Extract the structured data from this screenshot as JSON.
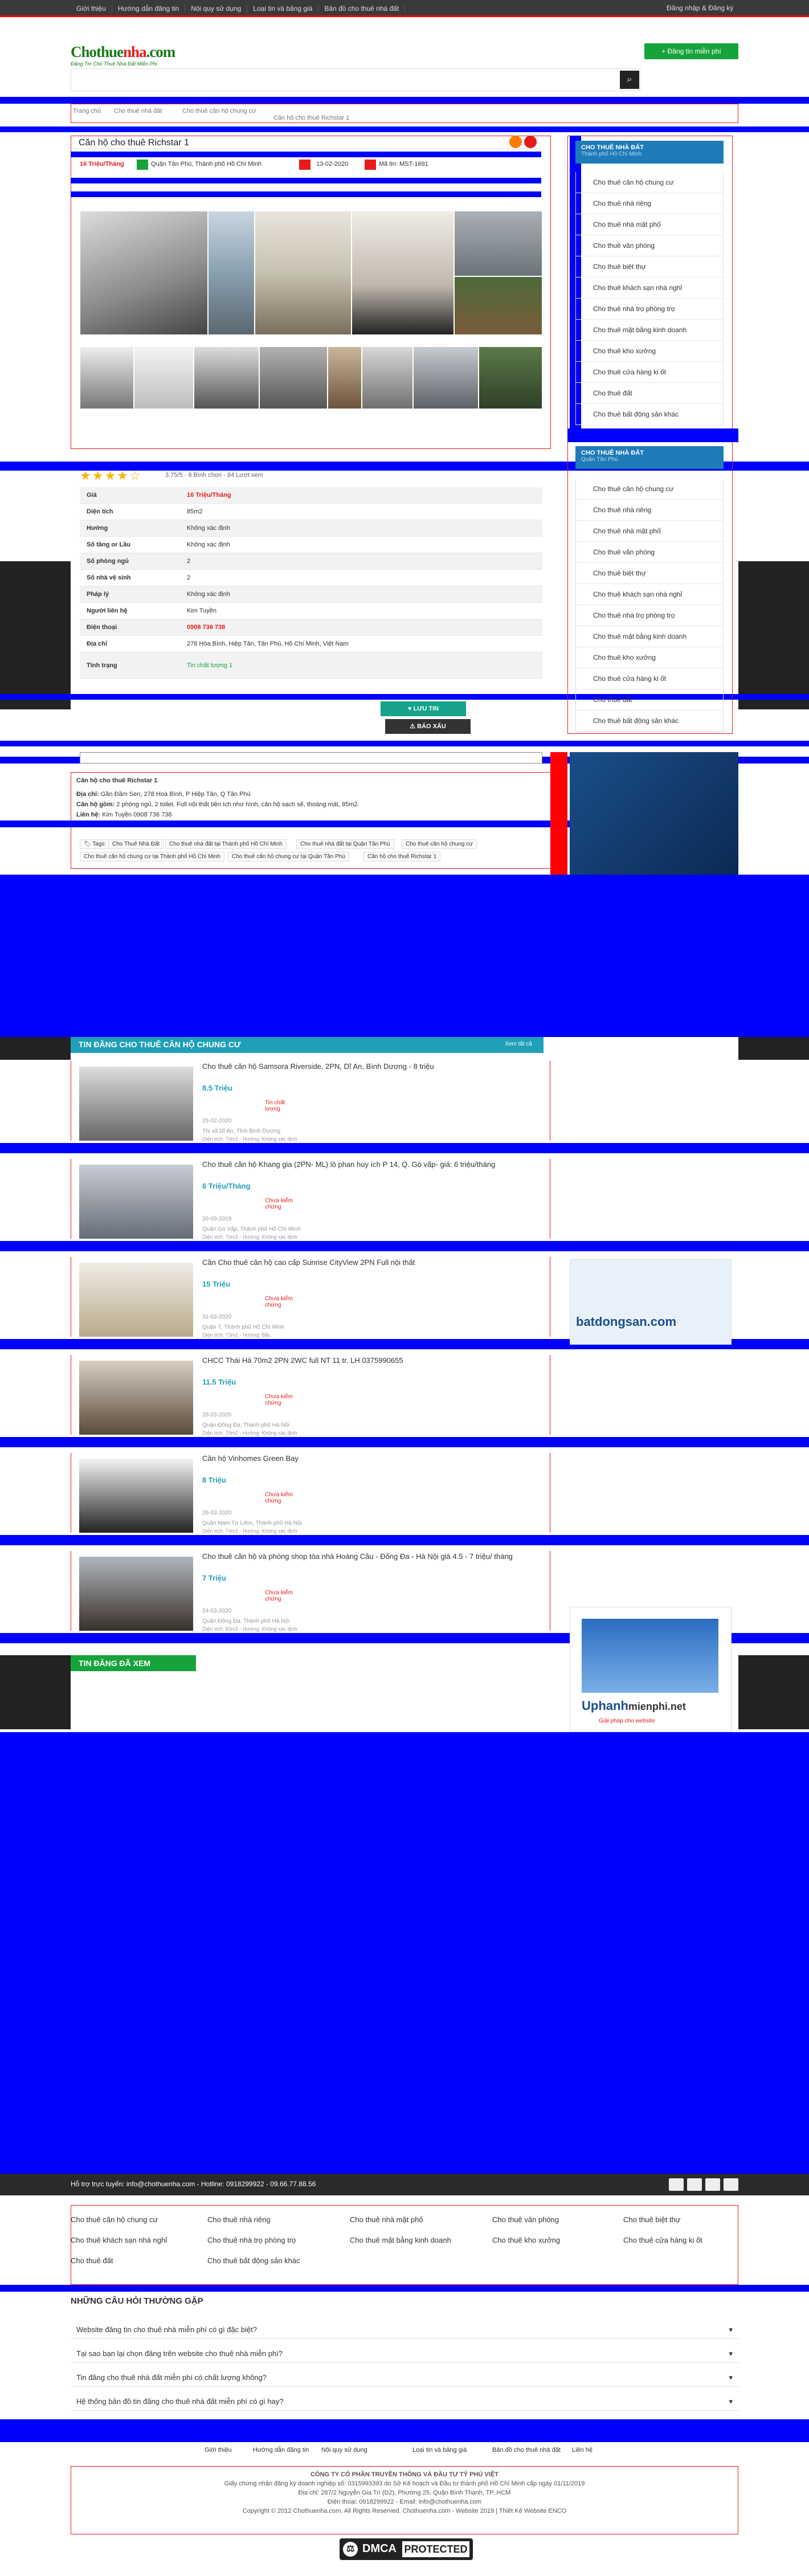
{
  "topbar": {
    "menu": [
      "Giới thiệu",
      "Hướng dẫn đăng tin",
      "Nội quy sử dụng",
      "Loại tin và bảng giá",
      "Bản đồ cho thuê nhà đất"
    ],
    "login": "Đăng nhập & Đăng ký"
  },
  "header": {
    "logo_main": "Chothue",
    "logo_accent": "nha",
    "logo_tld": ".com",
    "logo_tagline": "Đăng Tin Cho Thuê Nhà Đất Miễn Phí",
    "post_button": "Đăng tin miễn phí"
  },
  "breadcrumb": [
    "Trang chủ",
    "Cho thuê nhà đất",
    "Cho thuê căn hộ chung cư",
    "Căn hộ cho thuê Richstar 1"
  ],
  "listing": {
    "title": "Căn hộ cho thuê Richstar 1",
    "price": "16 Triệu/Tháng",
    "location": "Quận Tân Phú, Thành phố Hồ Chí Minh",
    "date": "13-02-2020",
    "code": "Mã tin: MST-1691",
    "rating_text": "3.75/5 - 8 Bình chọn - 84 Lượt xem",
    "details": [
      {
        "k": "Giá",
        "v": "16 Triệu/Tháng"
      },
      {
        "k": "Diện tích",
        "v": "85m2"
      },
      {
        "k": "Hướng",
        "v": "Không xác định"
      },
      {
        "k": "Số tầng or Lầu",
        "v": "Không xác định"
      },
      {
        "k": "Số phòng ngủ",
        "v": "2"
      },
      {
        "k": "Số nhà vệ sinh",
        "v": "2"
      },
      {
        "k": "Pháp lý",
        "v": "Không xác định"
      },
      {
        "k": "Người liên hệ",
        "v": "Kim Tuyền"
      },
      {
        "k": "Điện thoại",
        "v": "0908 736 738"
      },
      {
        "k": "Địa chỉ",
        "v": "278 Hòa Bình, Hiệp Tân, Tân Phú, Hồ Chí Minh, Việt Nam"
      },
      {
        "k": "Tình trạng",
        "v": "Tin chất lượng 1"
      }
    ],
    "save_button": "LƯU TIN",
    "report_button": "BÁO XẤU"
  },
  "description": {
    "heading": "Căn hộ cho thuê Richstar 1",
    "address_label": "Địa chỉ:",
    "address": "Gần Đầm Sen, 278 Hoà Bình, P Hiệp Tân, Q Tân Phú",
    "structure_label": "Căn hộ gồm:",
    "structure": "2 phòng ngủ, 2 toilet. Full nội thất tiện ích như hình, căn hộ sạch sẽ, thoáng mát, 85m2.",
    "contact_label": "Liên hệ:",
    "contact": "Kim Tuyền 0908 736 738"
  },
  "tags": {
    "label": "Tags:",
    "items": [
      "Cho Thuê Nhà Đất",
      "Cho thuê nhà đất tại Thành phố Hồ Chí Minh",
      "Cho thuê nhà đất tại Quận Tân Phú",
      "Cho thuê căn hộ chung cư",
      "Cho thuê căn hộ chung cư tại Thành phố Hồ Chí Minh",
      "Cho thuê căn hộ chung cư tại Quận Tân Phú",
      "Căn hộ cho thuê Richstar 1"
    ]
  },
  "sidebar": {
    "box1_title": "CHO THUÊ NHÀ ĐẤT",
    "box1_sub": "Thành phố Hồ Chí Minh",
    "box1_items": [
      "Cho thuê căn hộ chung cư",
      "Cho thuê nhà riêng",
      "Cho thuê nhà mặt phố",
      "Cho thuê văn phòng",
      "Cho thuê biệt thự",
      "Cho thuê khách sạn nhà nghỉ",
      "Cho thuê nhà trọ phòng trọ",
      "Cho thuê mặt bằng kinh doanh",
      "Cho thuê kho xưởng",
      "Cho thuê cửa hàng ki ốt",
      "Cho thuê đất",
      "Cho thuê bất động sản khác"
    ],
    "box2_title": "CHO THUÊ NHÀ ĐẤT",
    "box2_sub": "Quận Tân Phú",
    "box2_items": [
      "Cho thuê căn hộ chung cư",
      "Cho thuê nhà riêng",
      "Cho thuê nhà mặt phố",
      "Cho thuê văn phòng",
      "Cho thuê biệt thự",
      "Cho thuê khách sạn nhà nghỉ",
      "Cho thuê nhà trọ phòng trọ",
      "Cho thuê mặt bằng kinh doanh",
      "Cho thuê kho xưởng",
      "Cho thuê cửa hàng ki ốt",
      "Cho thuê đất",
      "Cho thuê bất động sản khác"
    ]
  },
  "related": {
    "title": "TIN ĐĂNG CHO THUÊ CĂN HỘ CHUNG CƯ",
    "more": "Xem tất cả",
    "cards": [
      {
        "title": "Cho thuê căn hộ Samsora Riverside, 2PN, Dĩ An, Bình Dương - 8 triệu",
        "price": "8.5 Triệu",
        "status": "Tin chất lượng",
        "date": "25-02-2020",
        "addr": "Thị xã Dĩ An, Tỉnh Bình Dương",
        "size": "Diện tích: 70m2 - Hướng: Không xác định"
      },
      {
        "title": "Cho thuê căn hộ Khang gia (2PN- ML) lô phan huy ích P 14, Q. Gò vấp- giá: 6 triệu/tháng",
        "price": "6 Triệu/Tháng",
        "status": "Chưa kiểm chứng",
        "date": "20-09-2019",
        "addr": "Quận Gò Vấp, Thành phố Hồ Chí Minh",
        "size": "Diện tích: 70m2 - Hướng: Không xác định"
      },
      {
        "title": "Cần Cho thuê căn hộ cao cấp Sunrise CityView 2PN Full nội thất",
        "price": "15 Triệu",
        "status": "Chưa kiểm chứng",
        "date": "31-03-2020",
        "addr": "Quận 7, Thành phố Hồ Chí Minh",
        "size": "Diện tích: 73m2 - Hướng: Bắc"
      },
      {
        "title": "CHCC Thái Hà 70m2 2PN 2WC full NT 11 tr. LH 0375990655",
        "price": "11.5 Triệu",
        "status": "Chưa kiểm chứng",
        "date": "28-03-2020",
        "addr": "Quận Đống Đa, Thành phố Hà Nội",
        "size": "Diện tích: 70m2 - Hướng: Không xác định"
      },
      {
        "title": "Căn hộ Vinhomes Green Bay",
        "price": "8 Triệu",
        "status": "Chưa kiểm chứng",
        "date": "26-03-2020",
        "addr": "Quận Nam Từ Liêm, Thành phố Hà Nội",
        "size": "Diện tích: 74m2 - Hướng: Không xác định"
      },
      {
        "title": "Cho thuê căn hộ và phòng shop tòa nhà Hoàng Cầu - Đống Đa - Hà Nội giá 4.5 - 7 triệu/ tháng",
        "price": "7 Triệu",
        "status": "Chưa kiểm chứng",
        "date": "24-03-2020",
        "addr": "Quận Đống Đa, Thành phố Hà Nội",
        "size": "Diện tích: 50m2 - Hướng: Không xác định"
      }
    ]
  },
  "viewed": {
    "title": "TIN ĐĂNG ĐÃ XEM"
  },
  "banners": {
    "b1": "batdongsan.com",
    "b2_main": "Uphanh",
    "b2_sub": "mienphi.net",
    "b2_tag": "Giải pháp cho website"
  },
  "footer": {
    "support": "Hỗ trợ trực tuyến: info@chothuenha.com - Hotline: 0918299922 - 09.66.77.88.56",
    "links": [
      "Cho thuê căn hộ chung cư",
      "Cho thuê nhà riêng",
      "Cho thuê nhà mặt phố",
      "Cho thuê văn phòng",
      "Cho thuê biệt thự",
      "Cho thuê khách sạn nhà nghỉ",
      "Cho thuê nhà trọ phòng trọ",
      "Cho thuê mặt bằng kinh doanh",
      "Cho thuê kho xưởng",
      "Cho thuê cửa hàng ki ốt",
      "Cho thuê đất",
      "Cho thuê bất động sản khác"
    ],
    "faq_title": "NHỮNG CÂU HỎI THƯỜNG GẶP",
    "faq": [
      "Website đăng tin cho thuê nhà miễn phí có gì đặc biệt?",
      "Tại sao bạn lại chọn đăng trên website cho thuê nhà miễn phí?",
      "Tin đăng cho thuê nhà đất miễn phí có chất lượng không?",
      "Hệ thống bản đồ tin đăng cho thuê nhà đất miễn phí có gì hay?"
    ],
    "bottom_links": [
      "Giới thiệu",
      "Hướng dẫn đăng tin",
      "Nội quy sử dụng",
      "Loại tin và bảng giá",
      "Bản đồ cho thuê nhà đất",
      "Liên hệ"
    ],
    "company": "CÔNG TY CỔ PHẦN TRUYỀN THÔNG VÀ ĐẦU TƯ TỶ PHÚ VIỆT",
    "license": "Giấy chứng nhận đăng ký doanh nghiệp số: 0315993393 do Sở Kế hoạch và Đầu tư thành phố Hồ Chí Minh cấp ngày 01/11/2019",
    "address": "Địa chỉ: 287/2 Nguyễn Gia Trí (D2), Phường 25, Quận Bình Thạnh, TP. HCM",
    "phone": "Điện thoại: 0918299922 - Email: info@chothuenha.com",
    "copyright": "Copyright © 2012 Chothuenha.com. All Rights Reserved. Chothuenha.com - Website 2019 | Thiết Kế Website ENCO",
    "dmca_1": "DMCA",
    "dmca_2": "PROTECTED"
  }
}
